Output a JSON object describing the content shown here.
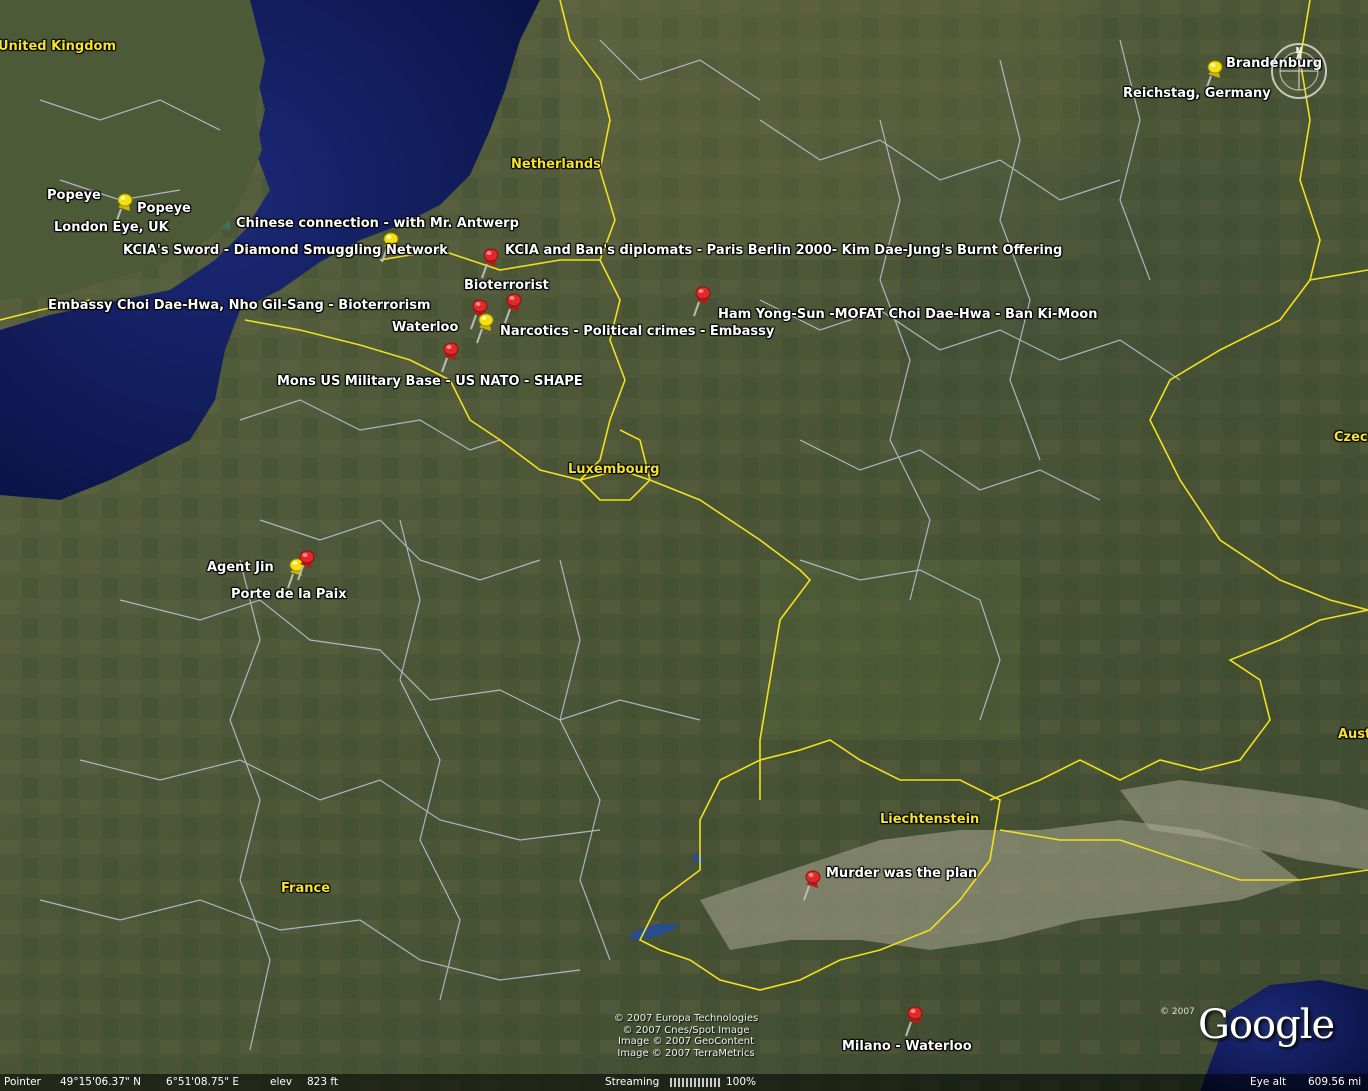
{
  "map": {
    "countries": [
      {
        "label": "United Kingdom"
      },
      {
        "label": "Netherlands"
      },
      {
        "label": "Luxembourg"
      },
      {
        "label": "France"
      },
      {
        "label": "Liechtenstein"
      },
      {
        "label": "Czec"
      },
      {
        "label": "Aust"
      }
    ],
    "placemarks": [
      {
        "label": "Popeye",
        "color": "yellow"
      },
      {
        "label": "Popeye"
      },
      {
        "label": "London Eye, UK"
      },
      {
        "label": "Chinese connection - with Mr. Antwerp",
        "color": "yellow"
      },
      {
        "label": "KCIA's Sword - Diamond Smuggling Network"
      },
      {
        "label": "KCIA and Ban's diplomats  - Paris Berlin 2000- Kim Dae-Jung's Burnt Offering",
        "color": "red"
      },
      {
        "label": "Bioterrorist",
        "color": "red"
      },
      {
        "label": "Embassy Choi Dae-Hwa, Nho Gil-Sang - Bioterrorism",
        "color": "red"
      },
      {
        "label": "Waterloo",
        "color": "yellow"
      },
      {
        "label": "Narcotics - Political crimes - Embassy"
      },
      {
        "label": "Ham Yong-Sun -MOFAT Choi Dae-Hwa - Ban Ki-Moon",
        "color": "red"
      },
      {
        "label": "Mons US Military Base - US NATO - SHAPE",
        "color": "red"
      },
      {
        "label": "Agent Jin",
        "color": "yellow"
      },
      {
        "label": "Porte de la Paix",
        "color": "red"
      },
      {
        "label": "Brandenburg",
        "color": "yellow"
      },
      {
        "label": "Reichstag, Germany"
      },
      {
        "label": "Murder was the plan",
        "color": "red"
      },
      {
        "label": "Milano - Waterloo",
        "color": "red"
      }
    ]
  },
  "credits": {
    "line1": "© 2007 Europa Technologies",
    "line2": "© 2007 Cnes/Spot Image",
    "line3": "Image © 2007 GeoContent",
    "line4": "Image © 2007 TerraMetrics"
  },
  "logo": {
    "text": "Google",
    "copyright": "© 2007"
  },
  "status": {
    "pointer_label": "Pointer",
    "lat": "49°15'06.37\" N",
    "lon": "6°51'08.75\" E",
    "elev_label": "elev",
    "elev": "823 ft",
    "streaming_label": "Streaming",
    "streaming_pct": "100%",
    "eye_alt_label": "Eye alt",
    "eye_alt": "609.56 mi"
  },
  "colors": {
    "sea": "#101a5a",
    "land": "#4c5535",
    "border": "#f0e020",
    "region": "#c8cce8",
    "pin_red": "#d42020",
    "pin_yellow": "#f2e010"
  }
}
